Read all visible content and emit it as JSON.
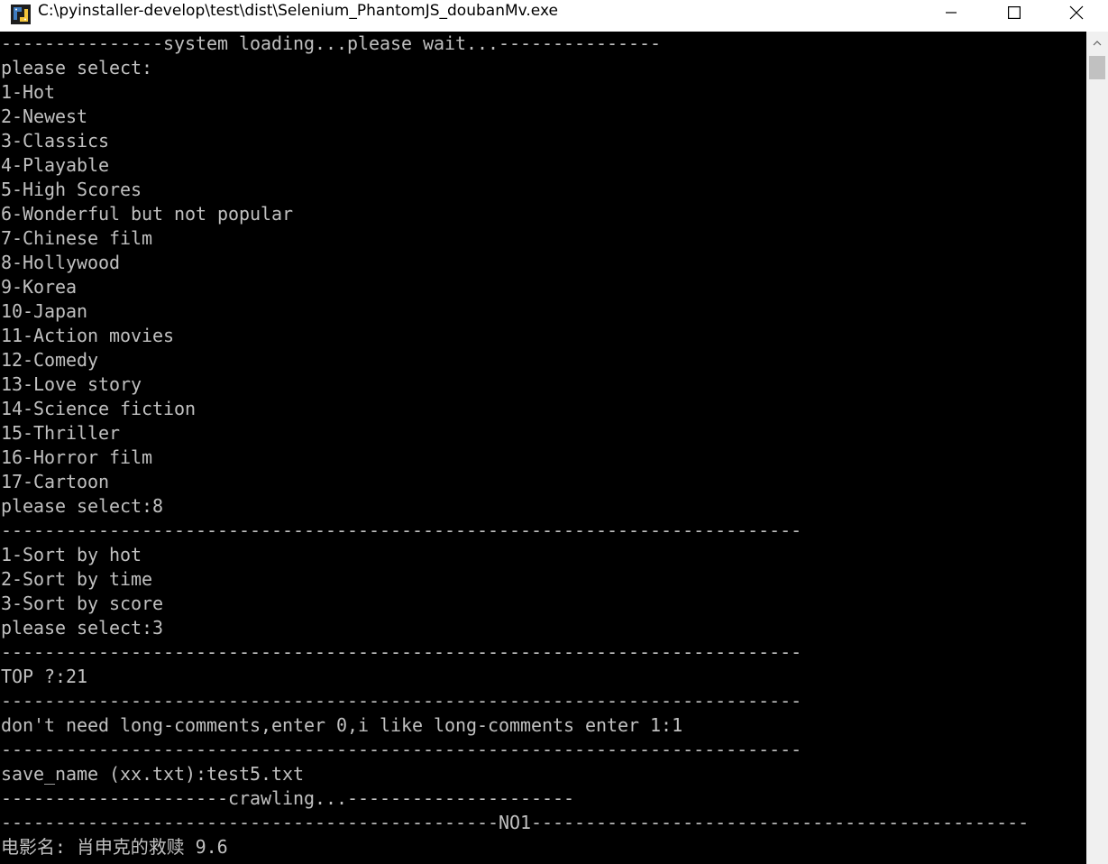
{
  "window": {
    "title": "C:\\pyinstaller-develop\\test\\dist\\Selenium_PhantomJS_doubanMv.exe",
    "icon": "python-app-icon",
    "controls": [
      "minimize-icon",
      "maximize-icon",
      "close-icon"
    ]
  },
  "console": {
    "text_color": "#c0c0c0",
    "background": "#000000",
    "lines": [
      "---------------system loading...please wait...---------------",
      "please select:",
      "1-Hot",
      "2-Newest",
      "3-Classics",
      "4-Playable",
      "5-High Scores",
      "6-Wonderful but not popular",
      "7-Chinese film",
      "8-Hollywood",
      "9-Korea",
      "10-Japan",
      "11-Action movies",
      "12-Comedy",
      "13-Love story",
      "14-Science fiction",
      "15-Thriller",
      "16-Horror film",
      "17-Cartoon",
      "please select:8",
      "--------------------------------------------------------------------------",
      "1-Sort by hot",
      "2-Sort by time",
      "3-Sort by score",
      "please select:3",
      "--------------------------------------------------------------------------",
      "TOP ?:21",
      "--------------------------------------------------------------------------",
      "don't need long-comments,enter 0,i like long-comments enter 1:1",
      "--------------------------------------------------------------------------",
      "save_name (xx.txt):test5.txt",
      "---------------------crawling...---------------------",
      "----------------------------------------------NO1----------------------------------------------",
      "电影名: 肖申克的救赎 9.6"
    ]
  }
}
